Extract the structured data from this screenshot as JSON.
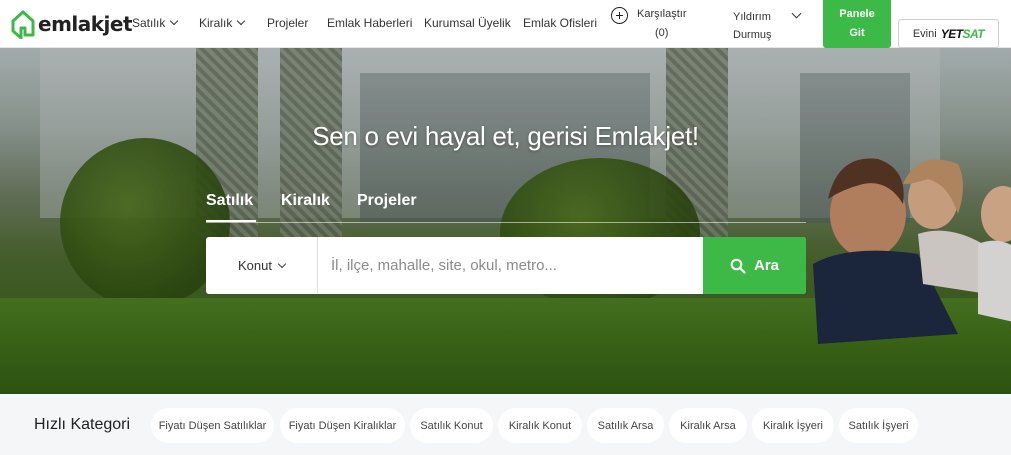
{
  "brand": {
    "name": "emlakjet",
    "accent": "#3db948"
  },
  "nav": {
    "items": [
      {
        "label": "Satılık",
        "dropdown": true
      },
      {
        "label": "Kiralık",
        "dropdown": true
      },
      {
        "label": "Projeler",
        "dropdown": false
      },
      {
        "label": "Emlak Haberleri",
        "dropdown": false
      },
      {
        "label": "Kurumsal Üyelik",
        "dropdown": false
      },
      {
        "label": "Emlak Ofisleri",
        "dropdown": false
      }
    ],
    "compare": {
      "label": "Karşılaştır",
      "count": "(0)",
      "icon": "plus-circle-icon"
    },
    "user": {
      "first": "Yıldırım",
      "last": "Durmuş"
    },
    "panel_button": {
      "line1": "Panele",
      "line2": "Git"
    },
    "sell_button": {
      "prefix": "Evini",
      "brand_a": "YET",
      "brand_b": "SAT"
    }
  },
  "hero": {
    "title": "Sen o evi hayal et, gerisi Emlakjet!",
    "tabs": [
      {
        "label": "Satılık",
        "active": true
      },
      {
        "label": "Kiralık",
        "active": false
      },
      {
        "label": "Projeler",
        "active": false
      }
    ],
    "search": {
      "type_value": "Konut",
      "placeholder": "İl, ilçe, mahalle, site, okul, metro...",
      "button_label": "Ara"
    }
  },
  "quick": {
    "title": "Hızlı Kategori",
    "chips": [
      "Fiyatı Düşen Satılıklar",
      "Fiyatı Düşen Kiralıklar",
      "Satılık Konut",
      "Kiralık Konut",
      "Satılık Arsa",
      "Kiralık Arsa",
      "Kiralık İşyeri",
      "Satılık İşyeri"
    ]
  }
}
